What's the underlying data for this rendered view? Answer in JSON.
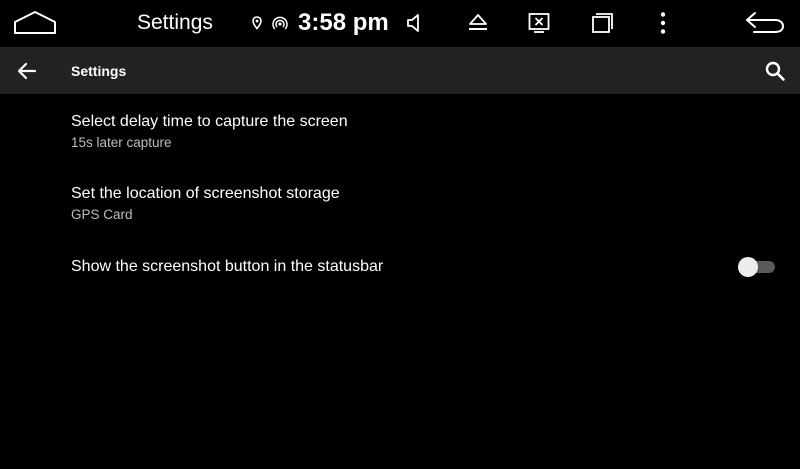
{
  "system_bar": {
    "title": "Settings",
    "time": "3:58 pm",
    "icons": [
      "home-icon",
      "location-icon",
      "hotspot-icon",
      "volume-icon",
      "eject-icon",
      "screenshot-close-icon",
      "recents-icon",
      "overflow-menu-icon",
      "back-icon"
    ]
  },
  "toolbar": {
    "title": "Settings",
    "icons": [
      "arrow-back-icon",
      "search-icon"
    ]
  },
  "preferences": [
    {
      "title": "Select delay time to capture the screen",
      "summary": "15s later capture"
    },
    {
      "title": "Set the location of screenshot storage",
      "summary": "GPS Card"
    },
    {
      "title": "Show the screenshot button in the statusbar",
      "switch_on": false
    }
  ],
  "colors": {
    "background": "#000000",
    "toolbar": "#222222",
    "summary_text": "#bdbdbd",
    "switch_track_off": "#5a5a5a",
    "switch_thumb_off": "#ececec"
  }
}
